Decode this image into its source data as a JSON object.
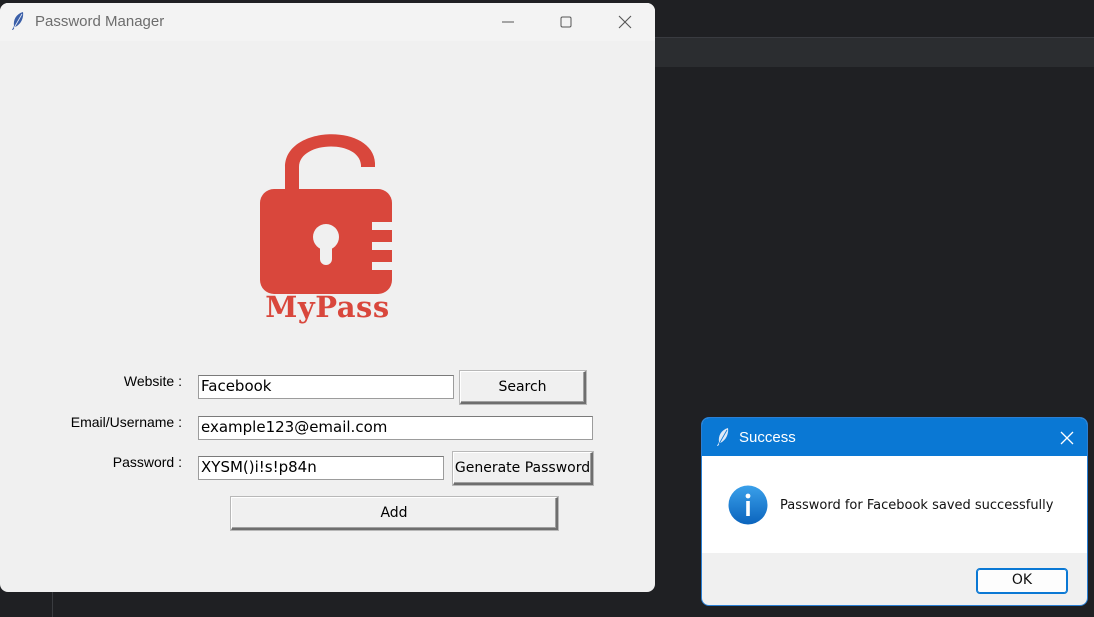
{
  "main_window": {
    "title": "Password Manager",
    "logo_text": "MyPass",
    "form": {
      "website_label": "Website :",
      "website_value": "Facebook",
      "email_label": "Email/Username :",
      "email_value": "example123@email.com",
      "password_label": "Password :",
      "password_value": "XYSM()i!s!p84n",
      "search_button": "Search",
      "generate_button": "Generate Password",
      "add_button": "Add"
    }
  },
  "dialog": {
    "title": "Success",
    "message": "Password for Facebook saved successfully",
    "ok_button": "OK"
  },
  "colors": {
    "logo_red": "#d9473c",
    "dialog_title_blue": "#0a78d4"
  }
}
